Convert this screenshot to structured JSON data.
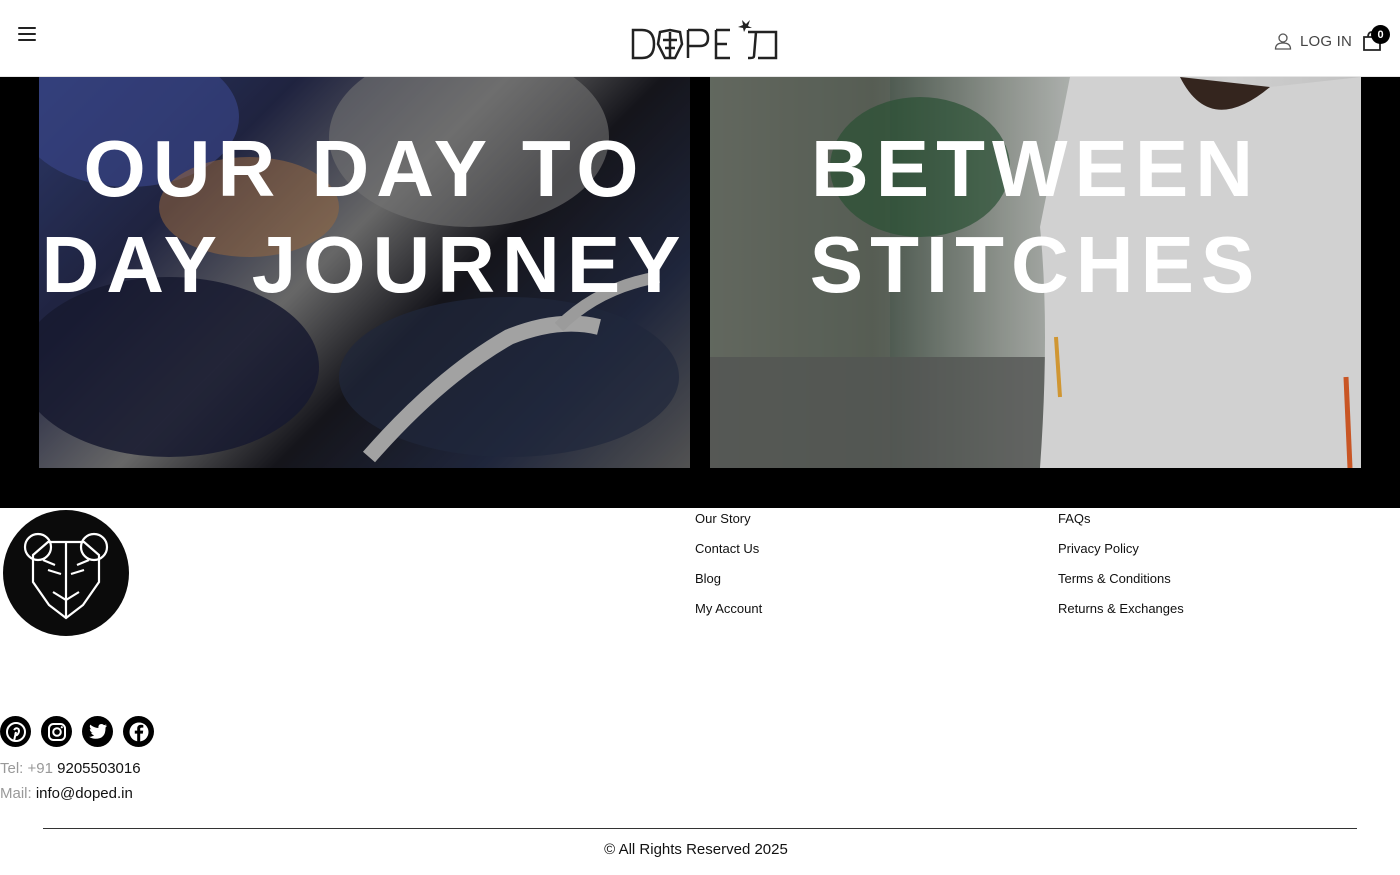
{
  "header": {
    "brand": "DOPED",
    "login_label": "LOG IN",
    "cart_count": "0"
  },
  "hero": {
    "left": {
      "line1": "OUR DAY TO",
      "line2": "DAY JOURNEY"
    },
    "right": {
      "line1": "BETWEEN",
      "line2": "STITCHES"
    }
  },
  "footer": {
    "links_col1": [
      "Our Story",
      "Contact Us",
      "Blog",
      "My Account"
    ],
    "links_col2": [
      "FAQs",
      "Privacy Policy",
      "Terms & Conditions",
      "Returns & Exchanges"
    ],
    "social": [
      "pinterest-icon",
      "instagram-icon",
      "twitter-icon",
      "facebook-icon"
    ],
    "tel_label": "Tel: +91",
    "tel_value": "9205503016",
    "mail_label": "Mail:",
    "mail_value": "info@doped.in",
    "copyright": "© All Rights Reserved 2025"
  }
}
